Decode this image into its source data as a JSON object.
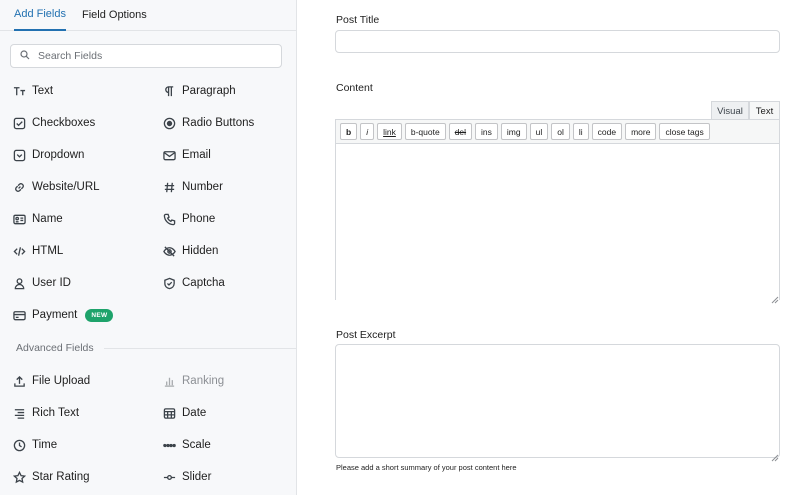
{
  "sidebar": {
    "tabs": [
      {
        "label": "Add Fields",
        "active": true
      },
      {
        "label": "Field Options",
        "active": false
      }
    ],
    "search": {
      "placeholder": "Search Fields",
      "value": ""
    },
    "fields": [
      {
        "label": "Text",
        "icon": "text-icon"
      },
      {
        "label": "Paragraph",
        "icon": "paragraph-icon"
      },
      {
        "label": "Checkboxes",
        "icon": "checkbox-icon"
      },
      {
        "label": "Radio Buttons",
        "icon": "radio-icon"
      },
      {
        "label": "Dropdown",
        "icon": "dropdown-icon"
      },
      {
        "label": "Email",
        "icon": "email-icon"
      },
      {
        "label": "Website/URL",
        "icon": "link-icon"
      },
      {
        "label": "Number",
        "icon": "hash-icon"
      },
      {
        "label": "Name",
        "icon": "name-card-icon"
      },
      {
        "label": "Phone",
        "icon": "phone-icon"
      },
      {
        "label": "HTML",
        "icon": "code-icon"
      },
      {
        "label": "Hidden",
        "icon": "eye-off-icon"
      },
      {
        "label": "User ID",
        "icon": "user-icon"
      },
      {
        "label": "Captcha",
        "icon": "shield-check-icon"
      },
      {
        "label": "Payment",
        "icon": "credit-card-icon",
        "badge": "NEW"
      }
    ],
    "advanced_title": "Advanced Fields",
    "advanced_fields": [
      {
        "label": "File Upload",
        "icon": "upload-icon"
      },
      {
        "label": "Ranking",
        "icon": "bar-chart-icon",
        "disabled": true
      },
      {
        "label": "Rich Text",
        "icon": "rich-text-icon"
      },
      {
        "label": "Date",
        "icon": "calendar-icon"
      },
      {
        "label": "Time",
        "icon": "clock-icon"
      },
      {
        "label": "Scale",
        "icon": "scale-dots-icon"
      },
      {
        "label": "Star Rating",
        "icon": "star-icon"
      },
      {
        "label": "Slider",
        "icon": "slider-icon"
      }
    ]
  },
  "main": {
    "post_title_label": "Post Title",
    "post_title_value": "",
    "content_label": "Content",
    "modes": {
      "visual": "Visual",
      "text": "Text"
    },
    "toolbar": [
      "b",
      "i",
      "link",
      "b-quote",
      "del",
      "ins",
      "img",
      "ul",
      "ol",
      "li",
      "code",
      "more",
      "close tags"
    ],
    "content_value": "",
    "excerpt_label": "Post Excerpt",
    "excerpt_value": "",
    "excerpt_help": "Please add a short summary of your post content here"
  },
  "colors": {
    "accent": "#2271b1",
    "badge": "#1ea36b",
    "sidebar_bg": "#f7f8fa",
    "border": "#d5d8dc"
  }
}
